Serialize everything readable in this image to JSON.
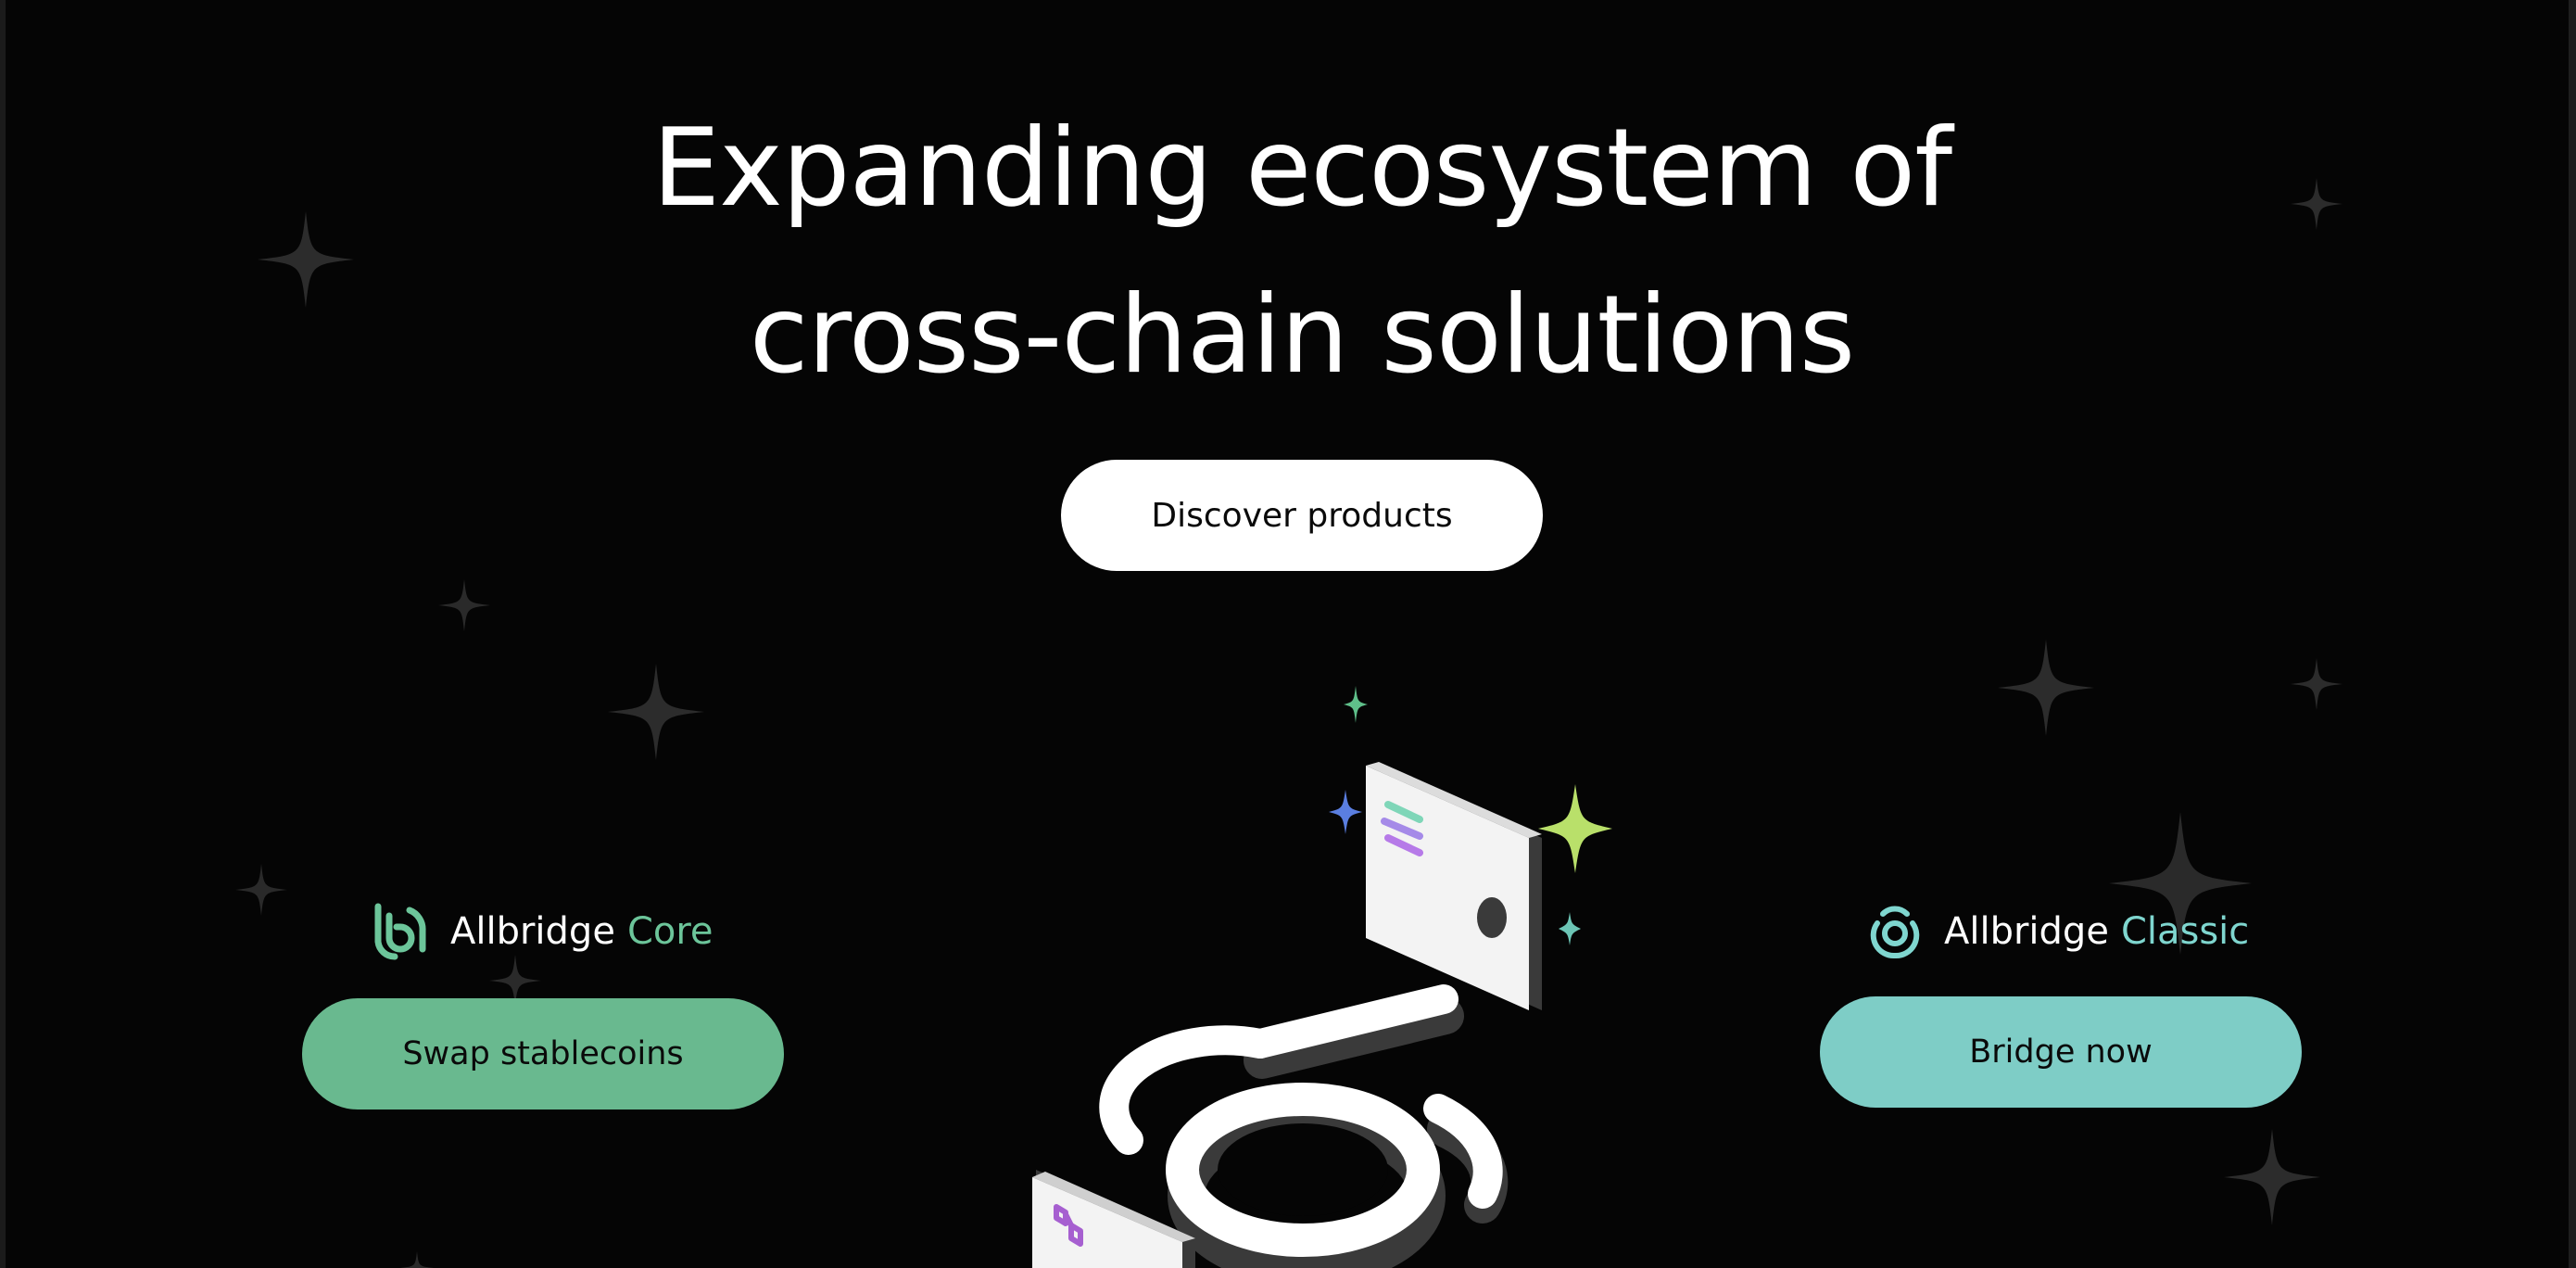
{
  "hero": {
    "title_line_1": "Expanding ecosystem of",
    "title_line_2": "cross-chain solutions"
  },
  "discover_button": {
    "label": "Discover products"
  },
  "products": {
    "core": {
      "brand": "Allbridge",
      "variant": "Core",
      "button_label": "Swap stablecoins",
      "accent_color": "#69b98f",
      "icon": "allbridge-core-logo-icon"
    },
    "classic": {
      "brand": "Allbridge",
      "variant": "Classic",
      "button_label": "Bridge now",
      "accent_color": "#7ecdc6",
      "icon": "allbridge-classic-logo-icon"
    }
  },
  "illustration": {
    "icons": [
      "solana-card-icon",
      "polygon-card-icon",
      "allbridge-3d-logo-icon",
      "sparkle-icon"
    ]
  },
  "colors": {
    "background": "#050505",
    "text": "#ffffff",
    "sparkle_dim": "#2a2a2a",
    "sparkle_green": "#b9e06a",
    "sparkle_blue": "#5a7ee0",
    "sparkle_teal": "#6cc5b5"
  }
}
